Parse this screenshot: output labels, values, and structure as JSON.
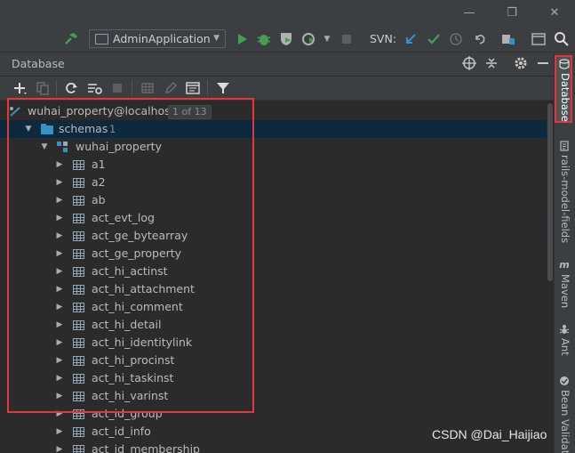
{
  "run_toolbar": {
    "config_label": "AdminApplication",
    "svn_label": "SVN:"
  },
  "tool_window": {
    "title": "Database"
  },
  "tree": {
    "datasource": {
      "label": "wuhai_property@localhost",
      "badge": "1 of 13"
    },
    "schemas": {
      "label": "schemas",
      "count": "1"
    },
    "schema": {
      "label": "wuhai_property"
    },
    "tables": [
      "a1",
      "a2",
      "ab",
      "act_evt_log",
      "act_ge_bytearray",
      "act_ge_property",
      "act_hi_actinst",
      "act_hi_attachment",
      "act_hi_comment",
      "act_hi_detail",
      "act_hi_identitylink",
      "act_hi_procinst",
      "act_hi_taskinst",
      "act_hi_varinst",
      "act_id_group",
      "act_id_info",
      "act_id_membership"
    ]
  },
  "right_tabs": {
    "database": "Database",
    "rails": "rails-model-fields",
    "maven": "Maven",
    "ant": "Ant",
    "bean": "Bean Validation"
  },
  "watermark": "CSDN @Dai_Haijiao",
  "colors": {
    "background": "#2b2b2b",
    "panel": "#3c3f41",
    "selection": "#0d293e",
    "folder": "#3592c4",
    "highlight": "#e0383e",
    "run_green": "#499c54"
  }
}
